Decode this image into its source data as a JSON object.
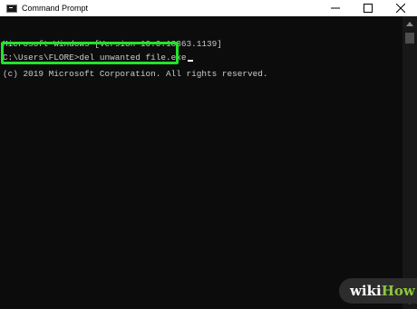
{
  "window": {
    "title": "Command Prompt",
    "controls": {
      "minimize_icon": "minimize-icon",
      "maximize_icon": "maximize-icon",
      "close_icon": "close-icon"
    }
  },
  "console": {
    "lines": [
      "Microsoft Windows [Version 10.0.18363.1139]",
      "(c) 2019 Microsoft Corporation. All rights reserved."
    ],
    "prompt": "C:\\Users\\FLORE>",
    "command": "del unwanted file.exe"
  },
  "highlight": {
    "color": "#22e32c"
  },
  "watermark": {
    "part1": "wiki",
    "part2": "How"
  },
  "colors": {
    "console_bg": "#0c0c0c",
    "console_text": "#cccccc",
    "titlebar_bg": "#ffffff"
  }
}
